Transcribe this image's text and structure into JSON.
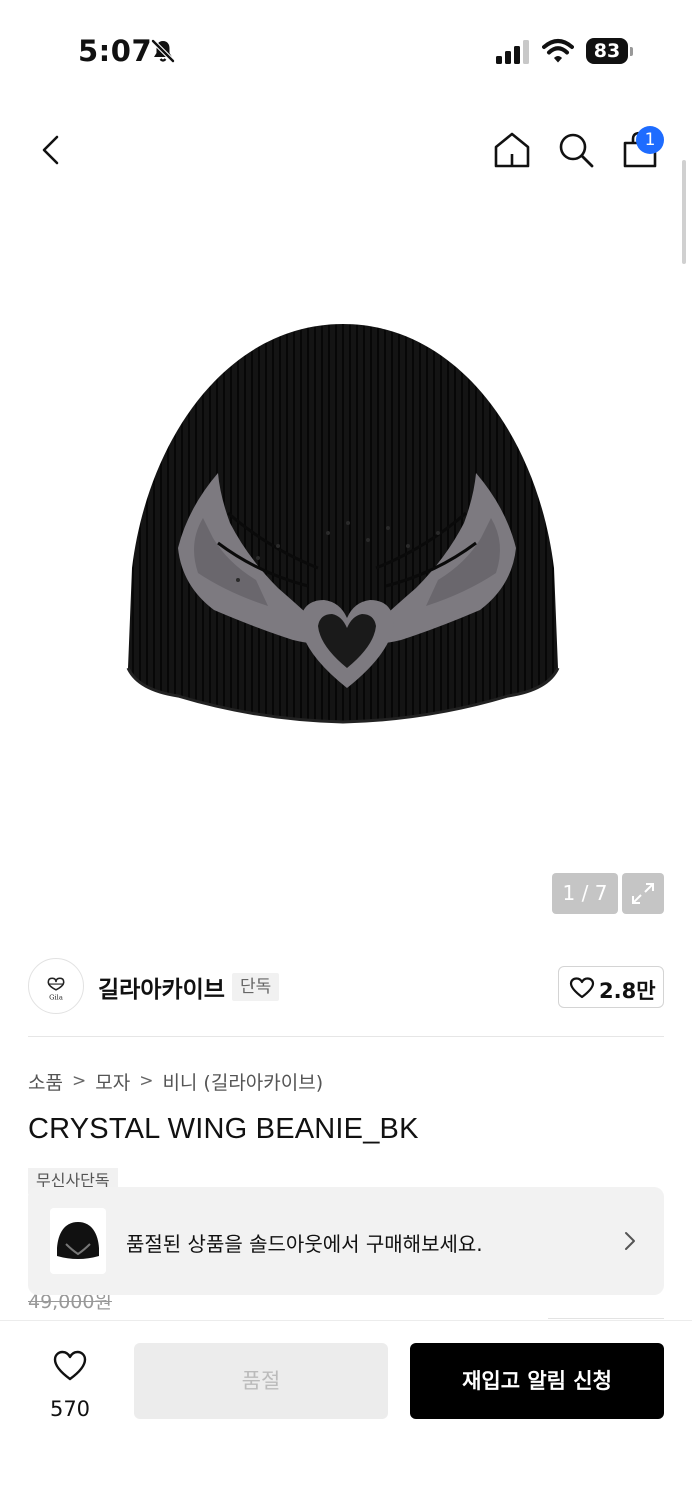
{
  "status_bar": {
    "time": "5:07",
    "battery": "83",
    "icons": [
      "bell-slash-icon",
      "cellular-signal-icon",
      "wifi-icon",
      "battery-icon"
    ]
  },
  "nav": {
    "icons": [
      "back-chevron-icon",
      "home-icon",
      "search-icon",
      "shopping-bag-icon"
    ],
    "cart_count": "1"
  },
  "gallery": {
    "page_indicator": "1 / 7",
    "expand_icon": "expand-icon"
  },
  "brand": {
    "name": "길라아카이브",
    "exclusive_tag": "단독",
    "logo_text": "Gila",
    "like_count": "2.8만"
  },
  "breadcrumb": {
    "items": [
      "소품",
      "모자",
      "비니 (길라아카이브)"
    ]
  },
  "product": {
    "title": "CRYSTAL WING BEANIE_BK",
    "musinsa_tag": "무신사단독",
    "old_price": "49,000원"
  },
  "soldout_banner": {
    "text": "품절된 상품을 솔드아웃에서 구매해보세요."
  },
  "bottom_bar": {
    "wish_count": "570",
    "soldout_label": "품절",
    "restock_label": "재입고 알림 신청"
  },
  "colors": {
    "accent_blue": "#1e6cff",
    "primary_black": "#000000",
    "disabled_gray": "#ececec"
  }
}
